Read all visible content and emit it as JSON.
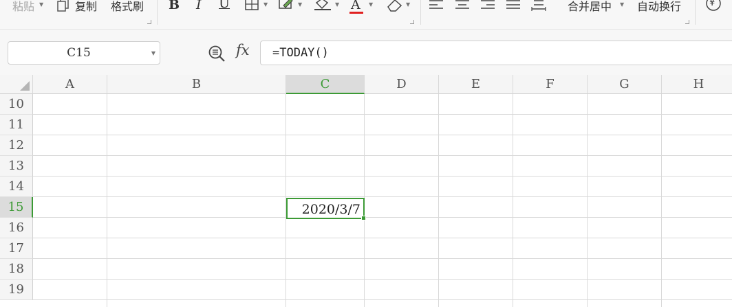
{
  "ribbon": {
    "paste_label": "粘贴",
    "copy_label": "复制",
    "format_painter_label": "格式刷",
    "bold_glyph": "B",
    "italic_glyph": "I",
    "underline_glyph": "U",
    "font_color_glyph": "A",
    "merge_center_label": "合并居中",
    "wrap_text_label": "自动换行",
    "currency_glyph": "¥",
    "accent_color": "#e02020"
  },
  "formula_bar": {
    "name_box": "C15",
    "fx_label": "fx",
    "formula": "=TODAY()"
  },
  "grid": {
    "columns": [
      "A",
      "B",
      "C",
      "D",
      "E",
      "F",
      "G",
      "H"
    ],
    "selected_column": "C",
    "rows": [
      "10",
      "11",
      "12",
      "13",
      "14",
      "15",
      "16",
      "17",
      "18",
      "19"
    ],
    "selected_row": "15",
    "active_cell_value": "2020/3/7",
    "selection_color": "#3c9a35"
  }
}
